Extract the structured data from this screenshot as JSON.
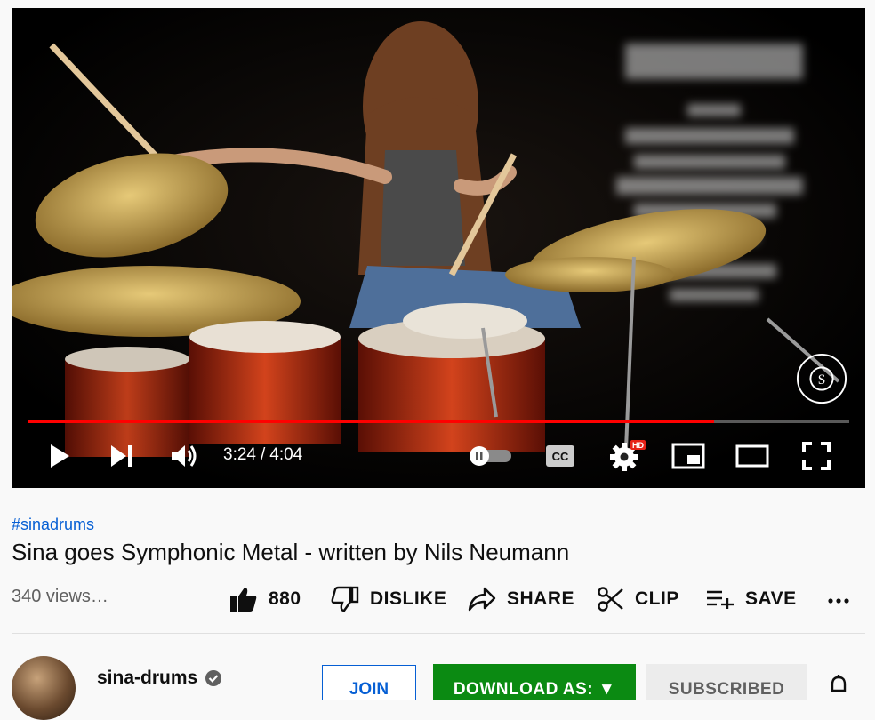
{
  "video": {
    "current_time": "3:24",
    "duration": "4:04",
    "progress_fraction": 0.836,
    "quality_badge": "HD",
    "subtitles_label": "CC"
  },
  "info": {
    "hashtag": "#sinadrums",
    "title": "Sina goes Symphonic Metal - written by Nils Neumann",
    "views": "340 views…"
  },
  "actions": {
    "like_count": "880",
    "dislike_label": "DISLIKE",
    "share_label": "SHARE",
    "clip_label": "CLIP",
    "save_label": "SAVE"
  },
  "channel": {
    "name": "sina-drums",
    "join_label": "JOIN",
    "download_label": "DOWNLOAD AS: ▼",
    "subscribed_label": "SUBSCRIBED"
  },
  "colors": {
    "accent_red": "#ff0000",
    "link_blue": "#065fd4",
    "download_green": "#0b8a12"
  },
  "icons": [
    "play-icon",
    "next-icon",
    "volume-icon",
    "autoplay-toggle-icon",
    "captions-icon",
    "settings-icon",
    "miniplayer-icon",
    "theater-icon",
    "fullscreen-icon",
    "like-icon",
    "dislike-icon",
    "share-icon",
    "clip-icon",
    "save-icon",
    "more-icon",
    "verified-icon",
    "bell-icon"
  ]
}
